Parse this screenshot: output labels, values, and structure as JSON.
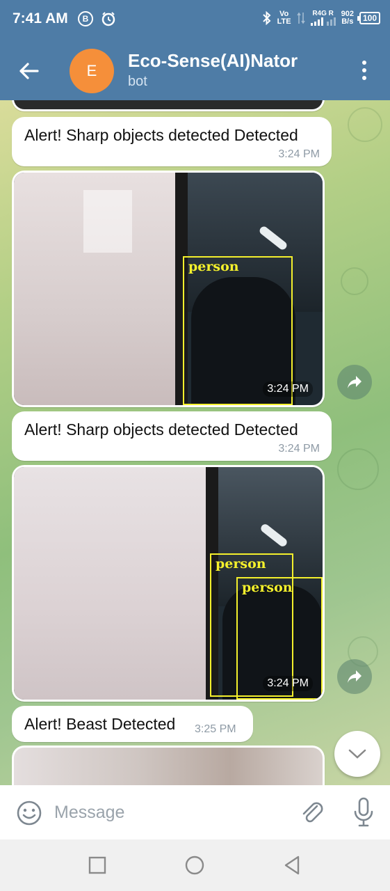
{
  "status_bar": {
    "time": "7:41 AM",
    "badge_b": "B",
    "network_top": "Vo",
    "network_bottom": "LTE",
    "carrier_top": "R4G",
    "carrier_letter": "R",
    "speed_value": "902",
    "speed_unit": "B/s",
    "battery": "100",
    "icons": [
      "b-badge-icon",
      "alarm-icon",
      "bluetooth-icon",
      "volte-icon",
      "data-arrows-icon",
      "signal-icon",
      "battery-icon"
    ]
  },
  "header": {
    "avatar_letter": "E",
    "title": "Eco-Sense(AI)Nator",
    "subtitle": "bot",
    "colors": {
      "bar": "#4e7ca6",
      "avatar": "#f58f3a"
    },
    "icons": [
      "back-arrow-icon",
      "more-vertical-icon"
    ]
  },
  "messages": [
    {
      "type": "text",
      "text": "Alert! Sharp objects detected Detected",
      "time": "3:24 PM"
    },
    {
      "type": "photo",
      "time": "3:24 PM",
      "detections": [
        "person"
      ]
    },
    {
      "type": "text",
      "text": "Alert! Sharp objects detected Detected",
      "time": "3:24 PM"
    },
    {
      "type": "photo",
      "time": "3:24 PM",
      "detections": [
        "person",
        "person"
      ]
    },
    {
      "type": "text",
      "text": "Alert! Beast Detected",
      "time": "3:25 PM"
    },
    {
      "type": "photo",
      "time": "",
      "detections": []
    }
  ],
  "input": {
    "placeholder": "Message",
    "icons": [
      "emoji-icon",
      "paperclip-icon",
      "microphone-icon"
    ]
  },
  "navbar": {
    "icons": [
      "recents-square-icon",
      "home-circle-icon",
      "back-triangle-icon"
    ]
  }
}
